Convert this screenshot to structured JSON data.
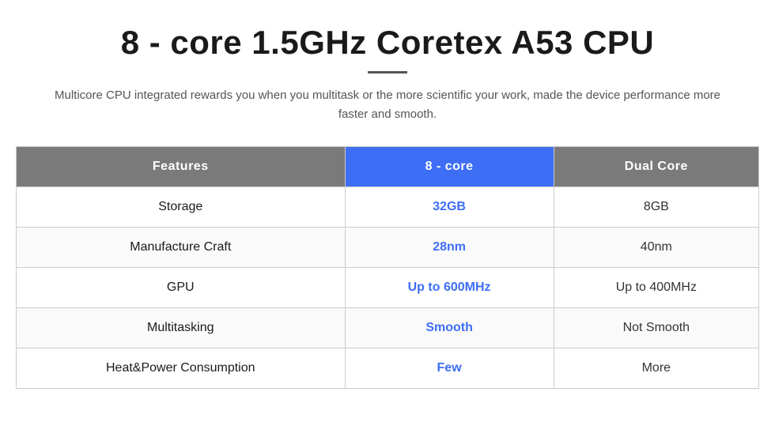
{
  "header": {
    "title": "8 - core 1.5GHz Coretex A53 CPU",
    "subtitle": "Multicore CPU integrated rewards you when you multitask or the more scientific your work, made the device performance more faster and smooth."
  },
  "table": {
    "columns": {
      "features": "Features",
      "octa": "8 - core",
      "dual": "Dual Core"
    },
    "rows": [
      {
        "feature": "Storage",
        "octa_value": "32GB",
        "dual_value": "8GB"
      },
      {
        "feature": "Manufacture Craft",
        "octa_value": "28nm",
        "dual_value": "40nm"
      },
      {
        "feature": "GPU",
        "octa_value": "Up to 600MHz",
        "dual_value": "Up to 400MHz"
      },
      {
        "feature": "Multitasking",
        "octa_value": "Smooth",
        "dual_value": "Not Smooth"
      },
      {
        "feature": "Heat&Power Consumption",
        "octa_value": "Few",
        "dual_value": "More"
      }
    ]
  }
}
